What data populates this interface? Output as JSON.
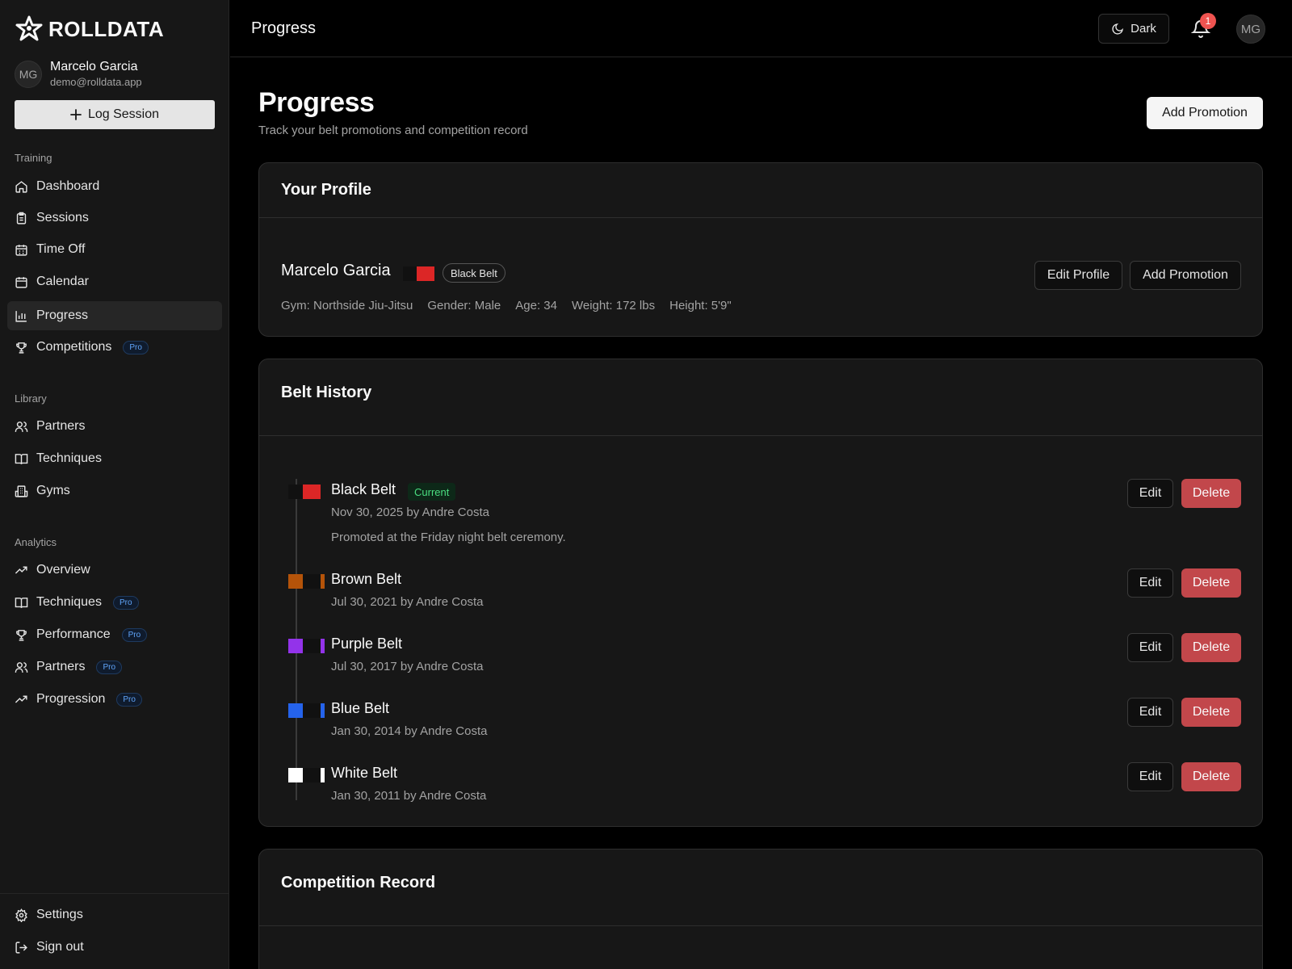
{
  "app": {
    "name": "ROLLDATA"
  },
  "user": {
    "initials": "MG",
    "name": "Marcelo Garcia",
    "email": "demo@rolldata.app"
  },
  "sidebar": {
    "log_session": "Log Session",
    "sections": {
      "training": "Training",
      "library": "Library",
      "analytics": "Analytics"
    },
    "training": [
      {
        "label": "Dashboard",
        "icon": "home-icon"
      },
      {
        "label": "Sessions",
        "icon": "clipboard-icon"
      },
      {
        "label": "Time Off",
        "icon": "calendar-grid-icon"
      },
      {
        "label": "Calendar",
        "icon": "calendar-icon"
      },
      {
        "label": "Progress",
        "icon": "bar-chart-icon",
        "active": true
      },
      {
        "label": "Competitions",
        "icon": "trophy-icon",
        "pro": "Pro"
      }
    ],
    "library": [
      {
        "label": "Partners",
        "icon": "users-icon"
      },
      {
        "label": "Techniques",
        "icon": "book-icon"
      },
      {
        "label": "Gyms",
        "icon": "building-icon"
      }
    ],
    "analytics": [
      {
        "label": "Overview",
        "icon": "trending-icon"
      },
      {
        "label": "Techniques",
        "icon": "book-icon",
        "pro": "Pro"
      },
      {
        "label": "Performance",
        "icon": "trophy-icon",
        "pro": "Pro"
      },
      {
        "label": "Partners",
        "icon": "users-icon",
        "pro": "Pro"
      },
      {
        "label": "Progression",
        "icon": "trending-icon",
        "pro": "Pro"
      }
    ],
    "bottom": [
      {
        "label": "Settings",
        "icon": "gear-icon"
      },
      {
        "label": "Sign out",
        "icon": "sign-out-icon"
      }
    ]
  },
  "topbar": {
    "title": "Progress",
    "theme_label": "Dark",
    "notification_count": "1",
    "avatar": "MG"
  },
  "page": {
    "title": "Progress",
    "subtitle": "Track your belt promotions and competition record",
    "add_promotion": "Add Promotion"
  },
  "profile": {
    "card_title": "Your Profile",
    "name": "Marcelo Garcia",
    "belt": "Black Belt",
    "gym": "Gym: Northside Jiu-Jitsu",
    "gender": "Gender: Male",
    "age": "Age: 34",
    "weight": "Weight: 172 lbs",
    "height": "Height: 5'9\"",
    "edit_profile": "Edit Profile",
    "add_promotion": "Add Promotion"
  },
  "belt_history": {
    "card_title": "Belt History",
    "current_tag": "Current",
    "edit": "Edit",
    "delete": "Delete",
    "belts": [
      {
        "name": "Black Belt",
        "date": "Nov 30, 2025 by Andre Costa",
        "note": "Promoted at the Friday night belt ceremony.",
        "color": "#111111",
        "bar": "#dc2626",
        "current": true
      },
      {
        "name": "Brown Belt",
        "date": "Jul 30, 2021 by Andre Costa",
        "color": "#b45309",
        "bar": "#111111"
      },
      {
        "name": "Purple Belt",
        "date": "Jul 30, 2017 by Andre Costa",
        "color": "#9333ea",
        "bar": "#111111"
      },
      {
        "name": "Blue Belt",
        "date": "Jan 30, 2014 by Andre Costa",
        "color": "#2563eb",
        "bar": "#111111"
      },
      {
        "name": "White Belt",
        "date": "Jan 30, 2011 by Andre Costa",
        "color": "#ffffff",
        "bar": "#111111"
      }
    ]
  },
  "competition": {
    "card_title": "Competition Record"
  }
}
